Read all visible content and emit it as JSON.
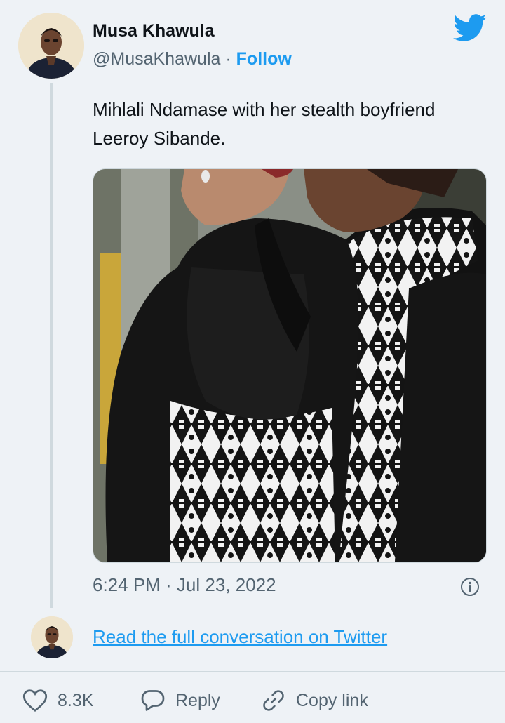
{
  "author": {
    "name": "Musa Khawula",
    "handle": "@MusaKhawula",
    "separator": "·",
    "follow_label": "Follow"
  },
  "tweet": {
    "text": "Mihlali Ndamase with her stealth boyfriend Leeroy Sibande.",
    "timestamp": "6:24 PM · Jul 23, 2022"
  },
  "footer": {
    "read_link": "Read the full conversation on Twitter"
  },
  "actions": {
    "likes": "8.3K",
    "reply_label": "Reply",
    "copy_link_label": "Copy link"
  },
  "icons": {
    "brand": "twitter-bird-icon",
    "info": "info-icon",
    "like": "heart-icon",
    "reply": "reply-bubble-icon",
    "copy": "link-icon"
  },
  "colors": {
    "accent": "#1d9bf0",
    "muted": "#536471",
    "background": "#eef2f6"
  }
}
